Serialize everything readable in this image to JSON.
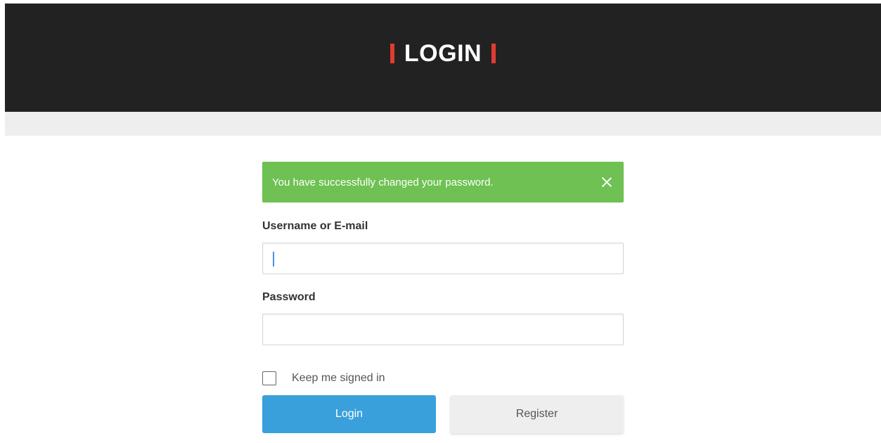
{
  "header": {
    "title": "LOGIN"
  },
  "alert": {
    "message": "You have successfully changed your password.",
    "close_icon": "close-icon"
  },
  "form": {
    "username_label": "Username or E-mail",
    "username_value": "",
    "password_label": "Password",
    "password_value": "",
    "remember_label": "Keep me signed in",
    "remember_checked": false,
    "login_label": "Login",
    "register_label": "Register"
  },
  "colors": {
    "header_bg": "#222222",
    "accent_red": "#e03c31",
    "alert_green": "#6ec152",
    "login_blue": "#3aa0dc",
    "register_gray": "#eeeeee"
  }
}
